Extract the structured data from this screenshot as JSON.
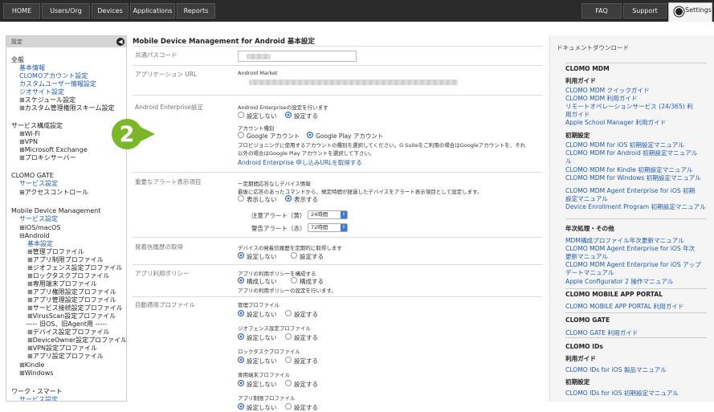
{
  "topbar": {
    "tabs": [
      {
        "label": "HOME"
      },
      {
        "label": "Users/Org"
      },
      {
        "label": "Devices"
      },
      {
        "label": "Applications"
      },
      {
        "label": "Reports"
      }
    ],
    "faq": "FAQ",
    "support": "Support",
    "settings": "Settings"
  },
  "sidebar": {
    "header": "設定",
    "items": [
      {
        "text": "全般",
        "kind": "hd"
      },
      {
        "text": "基本情報",
        "kind": "link"
      },
      {
        "text": "CLOMOアカウント設定",
        "kind": "link"
      },
      {
        "text": "カスタムユーザー情報設定",
        "kind": "link"
      },
      {
        "text": "ジオサイト設定",
        "kind": "link"
      },
      {
        "text": "⊞スケジュール設定",
        "kind": "hd"
      },
      {
        "text": "⊞カスタム管理権限スキーム設定",
        "kind": "hd"
      },
      {
        "text": "サービス構成設定",
        "kind": "hd"
      },
      {
        "text": "⊞Wi-Fi",
        "kind": "hd"
      },
      {
        "text": "⊞VPN",
        "kind": "hd"
      },
      {
        "text": "⊞Microsoft Exchange",
        "kind": "hd"
      },
      {
        "text": "⊞プロキシサーバー",
        "kind": "hd"
      },
      {
        "text": "CLOMO GATE",
        "kind": "hd"
      },
      {
        "text": "サービス設定",
        "kind": "link"
      },
      {
        "text": "⊞アクセスコントロール",
        "kind": "hd"
      },
      {
        "text": "Mobile Device Management",
        "kind": "hd"
      },
      {
        "text": "サービス設定",
        "kind": "link"
      },
      {
        "text": "⊞iOS/macOS",
        "kind": "hd"
      },
      {
        "text": "⊟Android",
        "kind": "hd"
      },
      {
        "text": "基本設定",
        "kind": "link"
      },
      {
        "text": "⊞管理プロファイル",
        "kind": "hd"
      },
      {
        "text": "⊞アプリ制限プロファイル",
        "kind": "hd"
      },
      {
        "text": "⊞ジオフェンス設定プロファイル",
        "kind": "hd"
      },
      {
        "text": "⊞ロックタスクプロファイル",
        "kind": "hd"
      },
      {
        "text": "⊞専用端末プロファイル",
        "kind": "hd"
      },
      {
        "text": "⊞アプリ権限設定プロファイル",
        "kind": "hd"
      },
      {
        "text": "⊞アプリ管理設定プロファイル",
        "kind": "hd"
      },
      {
        "text": "⊞サービス接続設定プロファイル",
        "kind": "hd"
      },
      {
        "text": "⊞VirusScan設定プロファイル",
        "kind": "hd"
      },
      {
        "text": "----- 旧OS、旧Agent用 -----",
        "kind": "hd"
      },
      {
        "text": "⊞デバイス設定プロファイル",
        "kind": "hd"
      },
      {
        "text": "⊞DeviceOwner設定プロファイル",
        "kind": "hd"
      },
      {
        "text": "⊞VPN設定プロファイル",
        "kind": "hd"
      },
      {
        "text": "⊞アプリ設定プロファイル",
        "kind": "hd"
      },
      {
        "text": "⊞Kindle",
        "kind": "hd"
      },
      {
        "text": "⊞Windows",
        "kind": "hd"
      },
      {
        "text": "ワーク・スマート",
        "kind": "hd"
      },
      {
        "text": "サービス設定",
        "kind": "link"
      }
    ]
  },
  "main": {
    "title": "Mobile Device Management for Android 基本設定",
    "common_passcode_label": "共通パスコード",
    "app_url_label": "アプリケーション URL",
    "android_market": "Android Market",
    "enterprise_label": "Android Enterprise設定",
    "enterprise_q": "Android Enterpriseの設定を行います",
    "no_set": "設定しない",
    "set": "設定する",
    "account_type": "アカウント種別",
    "google_account": "Google アカウント",
    "google_play_account": "Google Play アカウント",
    "account_desc1": "プロビジョニングに使用するアカウントの種別を選択してください。G Suiteをご利用の場合はGoogleアカウントを、それ",
    "account_desc2": "以外の場合はGoogle Play アカウントを選択して下さい。",
    "enterprise_link": "Android Enterprise 申し込みURLを取得する",
    "alert_label": "重要なアラート表示項目",
    "alert_q": "一定期間応答なしデバイス情報",
    "alert_desc": "最後に応答のあったコマンドから、規定時間が経過したデバイスをアラート表示項目として設定します。",
    "hide": "表示しない",
    "show": "表示する",
    "caution_label": "注意アラート（黄）",
    "caution_value": "24時間",
    "warn_label": "警告アラート（赤）",
    "warn_value": "72時間",
    "history_label": "発着信履歴の取得",
    "history_q": "デバイスの発着信履歴を定期的に取得します",
    "policy_label": "アプリ利用ポリシー",
    "policy_q": "アプリの利用ポリシーを構成する",
    "policy_no": "構成しない",
    "policy_yes": "構成する",
    "policy_desc": "アプリの利用ポリシーの設定を行います。",
    "auto_label": "自動適用プロファイル",
    "auto_items": [
      {
        "name": "管理プロファイル"
      },
      {
        "name": "ジオフェンス設定プロファイル"
      },
      {
        "name": "ロックタスクプロファイル"
      },
      {
        "name": "専用端末プロファイル"
      },
      {
        "name": "アプリ制限プロファイル"
      }
    ]
  },
  "badge": {
    "number": "2",
    "color": "#7ab82a"
  },
  "right_panel": {
    "title": "ドキュメントダウンロード",
    "entries": [
      {
        "text": "CLOMO MDM",
        "kind": "rh"
      },
      {
        "text": "利用ガイド",
        "kind": "rh"
      },
      {
        "text": "CLOMO MDM クイックガイド",
        "kind": "rt"
      },
      {
        "text": "CLOMO MDM 利用ガイド",
        "kind": "rt"
      },
      {
        "text": "リモートオペレーションサービス (24/365) 利",
        "kind": "rt"
      },
      {
        "text": "用ガイド",
        "kind": "rt"
      },
      {
        "text": "Apple School Manager 利用ガイド",
        "kind": "rt"
      },
      {
        "text": "初期設定",
        "kind": "rh"
      },
      {
        "text": "CLOMO MDM for iOS 初期設定マニュアル",
        "kind": "rt"
      },
      {
        "text": "CLOMO MDM for Android 初期設定マニュアル",
        "kind": "rt"
      },
      {
        "text": "ル",
        "kind": "rt"
      },
      {
        "text": "CLOMO MDM for Kindle 初期設定マニュアル",
        "kind": "rt"
      },
      {
        "text": "CLOMO MDM for Windows 初期設定マニュアル",
        "kind": "rt"
      },
      {
        "text": "CLOMO MDM Agent Enterprise for iOS 初期",
        "kind": "rt"
      },
      {
        "text": "設定マニュアル",
        "kind": "rt"
      },
      {
        "text": "Device Enrollment Program 初期設定マニュアル",
        "kind": "rt"
      },
      {
        "text": "年次処理・その他",
        "kind": "rh"
      },
      {
        "text": "MDM構成プロファイル年次更新マニュアル",
        "kind": "rt"
      },
      {
        "text": "CLOMO MDM Agent Enterprise for iOS 年次",
        "kind": "rt"
      },
      {
        "text": "更新マニュアル",
        "kind": "rt"
      },
      {
        "text": "CLOMO MDM Agent Enterprise for iOS アップ",
        "kind": "rt"
      },
      {
        "text": "デートマニュアル",
        "kind": "rt"
      },
      {
        "text": "Apple Configurator 2 操作マニュアル",
        "kind": "rt"
      },
      {
        "text": "CLOMO MOBILE APP PORTAL",
        "kind": "rh"
      },
      {
        "text": "CLOMO MOBILE APP PORTAL 利用ガイド",
        "kind": "rt"
      },
      {
        "text": "CLOMO GATE",
        "kind": "rh"
      },
      {
        "text": "CLOMO GATE 利用ガイド",
        "kind": "rt"
      },
      {
        "text": "CLOMO IDs",
        "kind": "rh"
      },
      {
        "text": "利用ガイド",
        "kind": "rh"
      },
      {
        "text": "CLOMO IDs for iOS 製品マニュアル",
        "kind": "rt"
      },
      {
        "text": "初期設定",
        "kind": "rh"
      },
      {
        "text": "CLOMO IDs for iOS 初期設定マニュアル",
        "kind": "rt"
      }
    ]
  }
}
